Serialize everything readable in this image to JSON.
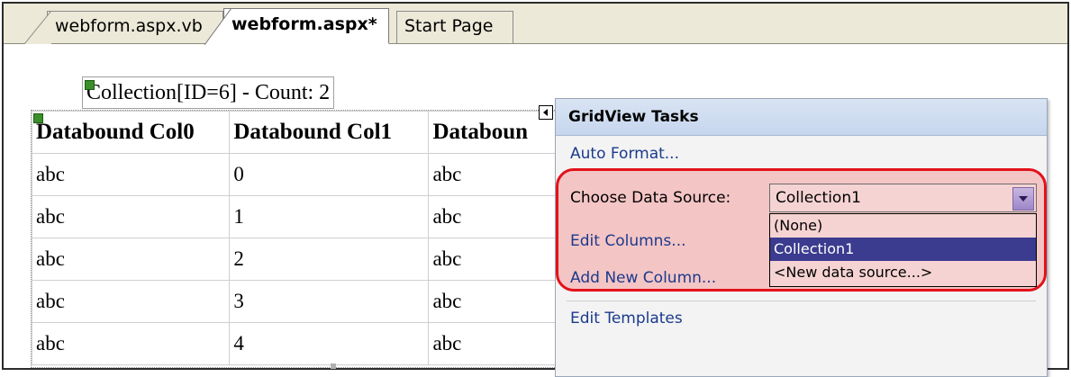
{
  "tabs": [
    {
      "label": "webform.aspx.vb",
      "active": false
    },
    {
      "label": "webform.aspx*",
      "active": true
    },
    {
      "label": "Start Page",
      "active": false
    }
  ],
  "collection_label": "Collection[ID=6] - Count: 2",
  "grid": {
    "headers": [
      "Databound Col0",
      "Databound Col1",
      "Databoun"
    ],
    "rows": [
      [
        "abc",
        "0",
        "abc"
      ],
      [
        "abc",
        "1",
        "abc"
      ],
      [
        "abc",
        "2",
        "abc"
      ],
      [
        "abc",
        "3",
        "abc"
      ],
      [
        "abc",
        "4",
        "abc"
      ]
    ]
  },
  "tasks_panel": {
    "title": "GridView Tasks",
    "auto_format": "Auto Format...",
    "choose_data_source_label": "Choose Data Source:",
    "selected_source": "Collection1",
    "options": [
      "(None)",
      "Collection1",
      "<New data source...>"
    ],
    "selected_option_index": 1,
    "edit_columns": "Edit Columns...",
    "add_new_column": "Add New Column...",
    "edit_templates": "Edit Templates"
  },
  "colors": {
    "highlight_border": "#e2121a",
    "highlight_fill": "#f4c5c5",
    "link": "#1b3a8c",
    "selected_option": "#3b3b8f"
  }
}
